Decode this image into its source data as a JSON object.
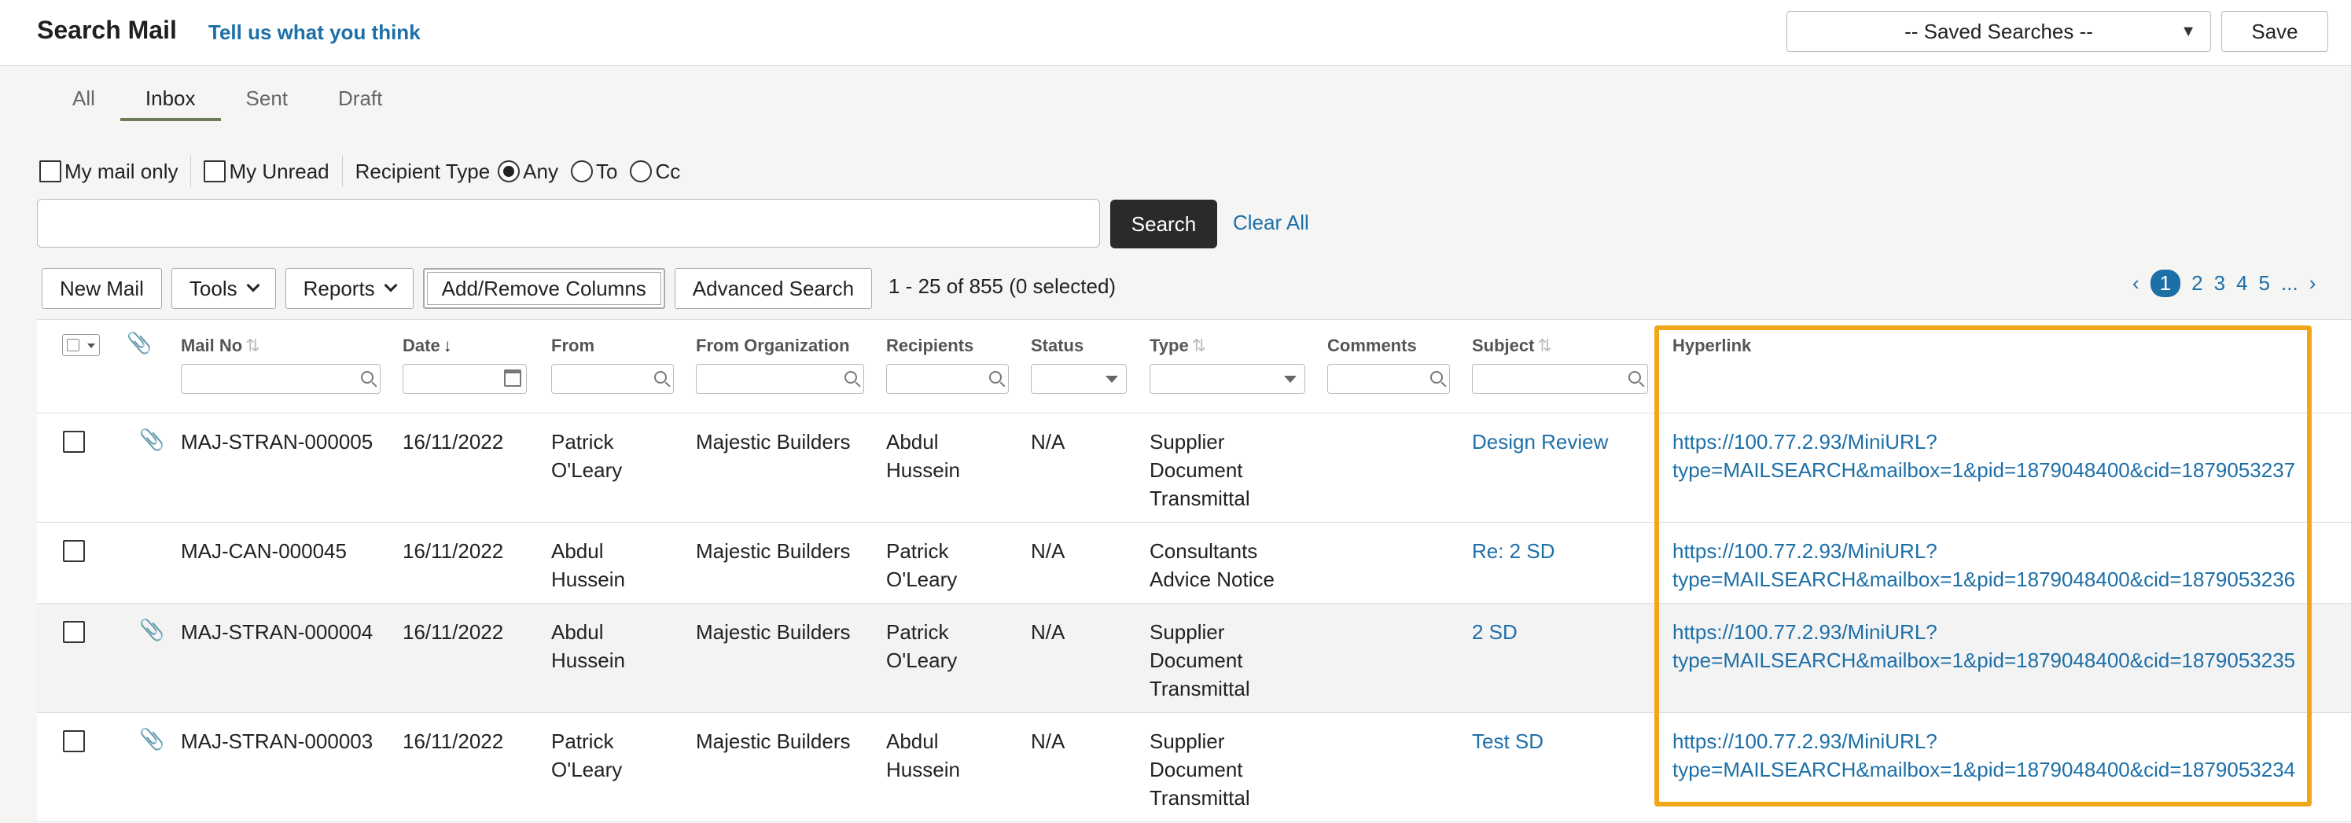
{
  "header": {
    "title": "Search Mail",
    "feedback_link": "Tell us what you think",
    "saved_searches": "-- Saved Searches --",
    "save": "Save"
  },
  "tabs": [
    {
      "label": "All",
      "active": false
    },
    {
      "label": "Inbox",
      "active": true
    },
    {
      "label": "Sent",
      "active": false
    },
    {
      "label": "Draft",
      "active": false
    }
  ],
  "filters": {
    "my_mail_only": "My mail only",
    "my_unread": "My Unread",
    "recipient_type": "Recipient Type",
    "any": "Any",
    "to": "To",
    "cc": "Cc",
    "selected_recipient_type": "Any"
  },
  "search": {
    "value": "",
    "button": "Search",
    "clear_all": "Clear All"
  },
  "toolbar": {
    "new_mail": "New Mail",
    "tools": "Tools",
    "reports": "Reports",
    "add_remove_columns": "Add/Remove Columns",
    "advanced_search": "Advanced Search",
    "result_count": "1 - 25 of 855 (0 selected)"
  },
  "pagination": {
    "prev": "‹",
    "pages": [
      "1",
      "2",
      "3",
      "4",
      "5"
    ],
    "current": "1",
    "ellipsis": "...",
    "next": "›"
  },
  "table": {
    "columns": {
      "mail_no": "Mail No",
      "date": "Date",
      "from": "From",
      "from_org": "From Organization",
      "recipients": "Recipients",
      "status": "Status",
      "type": "Type",
      "comments": "Comments",
      "subject": "Subject",
      "hyperlink": "Hyperlink"
    },
    "rows": [
      {
        "attachment": true,
        "mail_no": "MAJ-STRAN-000005",
        "date": "16/11/2022",
        "from": "Patrick O'Leary",
        "from_org": "Majestic Builders",
        "recipients": "Abdul Hussein",
        "status": "N/A",
        "type": "Supplier Document Transmittal",
        "comments": "",
        "subject": "Design Review",
        "hyperlink_1": "https://100.77.2.93/MiniURL?",
        "hyperlink_2": "type=MAILSEARCH&mailbox=1&pid=1879048400&cid=1879053237"
      },
      {
        "attachment": false,
        "mail_no": "MAJ-CAN-000045",
        "date": "16/11/2022",
        "from": "Abdul Hussein",
        "from_org": "Majestic Builders",
        "recipients": "Patrick O'Leary",
        "status": "N/A",
        "type": "Consultants Advice Notice",
        "comments": "",
        "subject": "Re: 2 SD",
        "hyperlink_1": "https://100.77.2.93/MiniURL?",
        "hyperlink_2": "type=MAILSEARCH&mailbox=1&pid=1879048400&cid=1879053236"
      },
      {
        "attachment": true,
        "mail_no": "MAJ-STRAN-000004",
        "date": "16/11/2022",
        "from": "Abdul Hussein",
        "from_org": "Majestic Builders",
        "recipients": "Patrick O'Leary",
        "status": "N/A",
        "type": "Supplier Document Transmittal",
        "comments": "",
        "subject": "2 SD",
        "hyperlink_1": "https://100.77.2.93/MiniURL?",
        "hyperlink_2": "type=MAILSEARCH&mailbox=1&pid=1879048400&cid=1879053235"
      },
      {
        "attachment": true,
        "mail_no": "MAJ-STRAN-000003",
        "date": "16/11/2022",
        "from": "Patrick O'Leary",
        "from_org": "Majestic Builders",
        "recipients": "Abdul Hussein",
        "status": "N/A",
        "type": "Supplier Document Transmittal",
        "comments": "",
        "subject": "Test SD",
        "hyperlink_1": "https://100.77.2.93/MiniURL?",
        "hyperlink_2": "type=MAILSEARCH&mailbox=1&pid=1879048400&cid=1879053234"
      }
    ]
  },
  "colors": {
    "accent_link": "#1d6fa8",
    "highlight": "#f0a818",
    "tab_underline": "#6f7d56",
    "search_button": "#2a2a2a"
  }
}
